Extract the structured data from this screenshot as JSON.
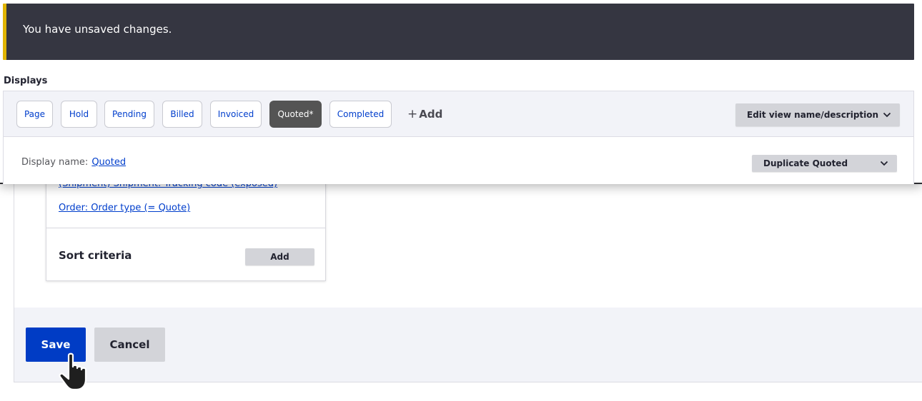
{
  "message": {
    "text": "You have unsaved changes.",
    "accent_color": "#e0b400",
    "background_color": "#353641"
  },
  "displays": {
    "heading": "Displays",
    "tabs": [
      {
        "label": "Page",
        "active": false
      },
      {
        "label": "Hold",
        "active": false
      },
      {
        "label": "Pending",
        "active": false
      },
      {
        "label": "Billed",
        "active": false
      },
      {
        "label": "Invoiced",
        "active": false
      },
      {
        "label": "Quoted*",
        "active": true
      },
      {
        "label": "Completed",
        "active": false
      }
    ],
    "add_label": "Add",
    "add_icon": "plus-icon",
    "edit_view_dropdown": "Edit view name/description",
    "display_name_label": "Display name:",
    "display_name_value": "Quoted",
    "duplicate_dropdown": "Duplicate Quoted",
    "dropdown_icon": "chevron-down-icon"
  },
  "filters": {
    "items": [
      "(Shipment) Shipment: Tracking code (exposed)",
      "Order: Order type (= Quote)"
    ]
  },
  "sort_criteria": {
    "title": "Sort criteria",
    "add_label": "Add"
  },
  "actions": {
    "save_label": "Save",
    "cancel_label": "Cancel",
    "primary_color": "#003cc5"
  },
  "cursor": {
    "icon": "hand-pointer-icon"
  }
}
